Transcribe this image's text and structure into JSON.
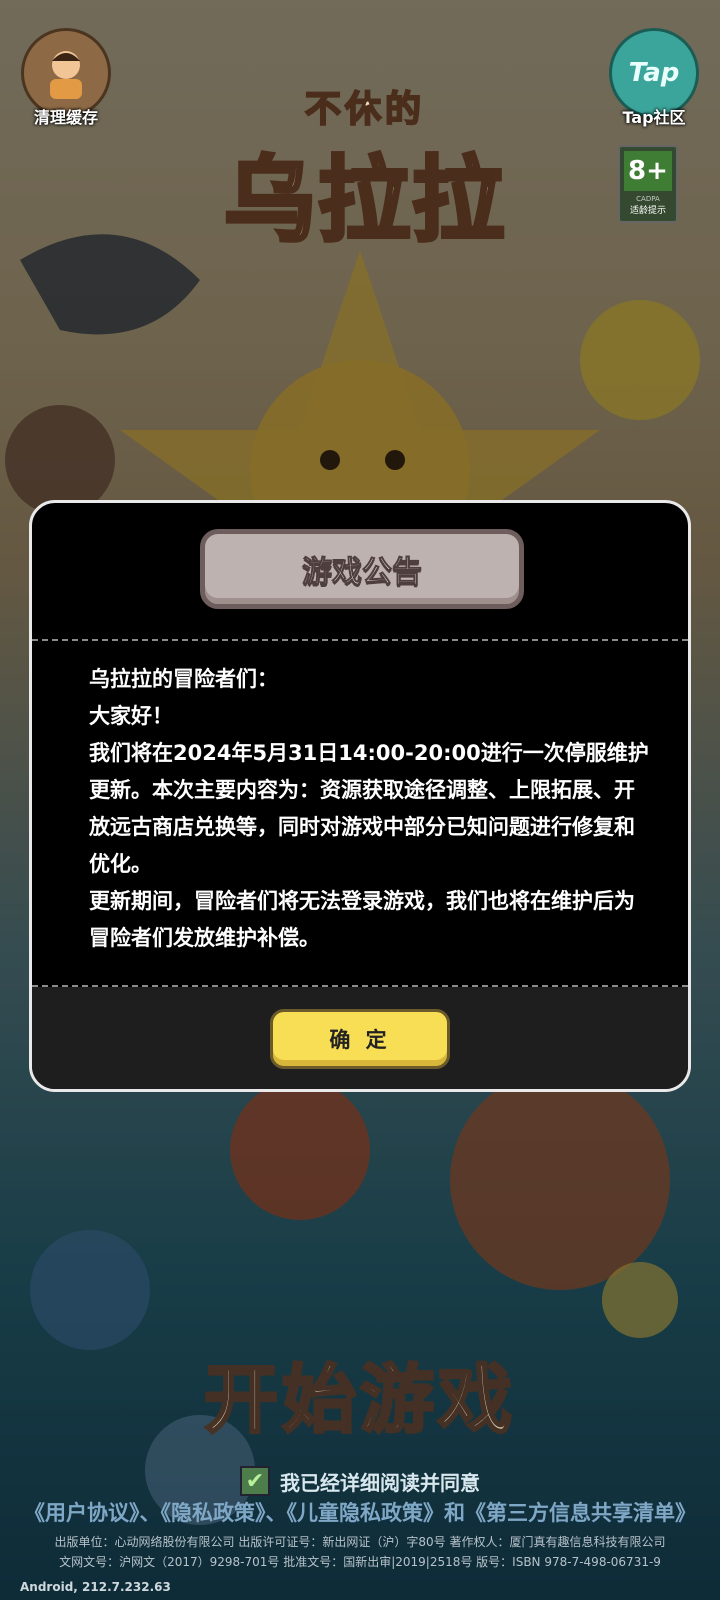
{
  "top": {
    "clear_cache_label": "清理缓存",
    "tap_label": "Tap社区",
    "tap_logo_text": "Tap",
    "age_rating": "8+",
    "age_org": "CADPA",
    "age_note": "适龄提示"
  },
  "logo": {
    "line1": "不休的",
    "line2": "乌拉拉"
  },
  "modal": {
    "title": "游戏公告",
    "paragraphs": [
      "乌拉拉的冒险者们：",
      "大家好！",
      "我们将在2024年5月31日14:00-20:00进行一次停服维护更新。本次主要内容为：资源获取途径调整、上限拓展、开放远古商店兑换等，同时对游戏中部分已知问题进行修复和优化。",
      "更新期间，冒险者们将无法登录游戏，我们也将在维护后为冒险者们发放维护补偿。"
    ],
    "confirm_label": "确 定"
  },
  "start_label": "开始游戏",
  "agreement": {
    "check_mark": "✔",
    "text": "我已经详细阅读并同意",
    "links": "《用户协议》、《隐私政策》、《儿童隐私政策》和《第三方信息共享清单》"
  },
  "publisher": {
    "line1": "出版单位：心动网络股份有限公司 出版许可证号：新出网证（沪）字80号 著作权人：厦门真有趣信息科技有限公司",
    "line2": "文网文号：沪网文（2017）9298-701号 批准文号：国新出审|2019|2518号 版号：ISBN 978-7-498-06731-9"
  },
  "version": "Android, 212.7.232.63",
  "colors": {
    "modal_bg": "#000000",
    "banner_bg": "#bdb2b0",
    "confirm_bg": "#f8de55",
    "link_color": "#7fa7c6"
  }
}
